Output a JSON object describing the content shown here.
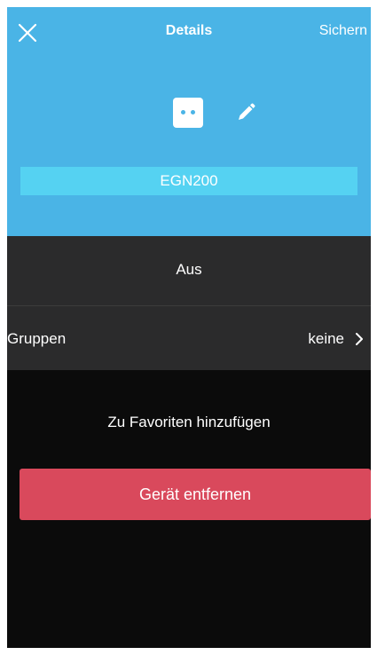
{
  "header": {
    "title": "Details",
    "save_label": "Sichern"
  },
  "device": {
    "icon": "power-socket-icon",
    "name": "EGN200"
  },
  "status": {
    "text": "Aus"
  },
  "groups": {
    "label": "Gruppen",
    "value": "keine"
  },
  "actions": {
    "favorite_label": "Zu Favoriten hinzufügen",
    "remove_label": "Gerät entfernen"
  },
  "colors": {
    "header_blue": "#4ab4e6",
    "name_field": "#55d2f2",
    "row_gray": "#2b2b2c",
    "background": "#0b0b0b",
    "remove_red": "#d9495c"
  }
}
